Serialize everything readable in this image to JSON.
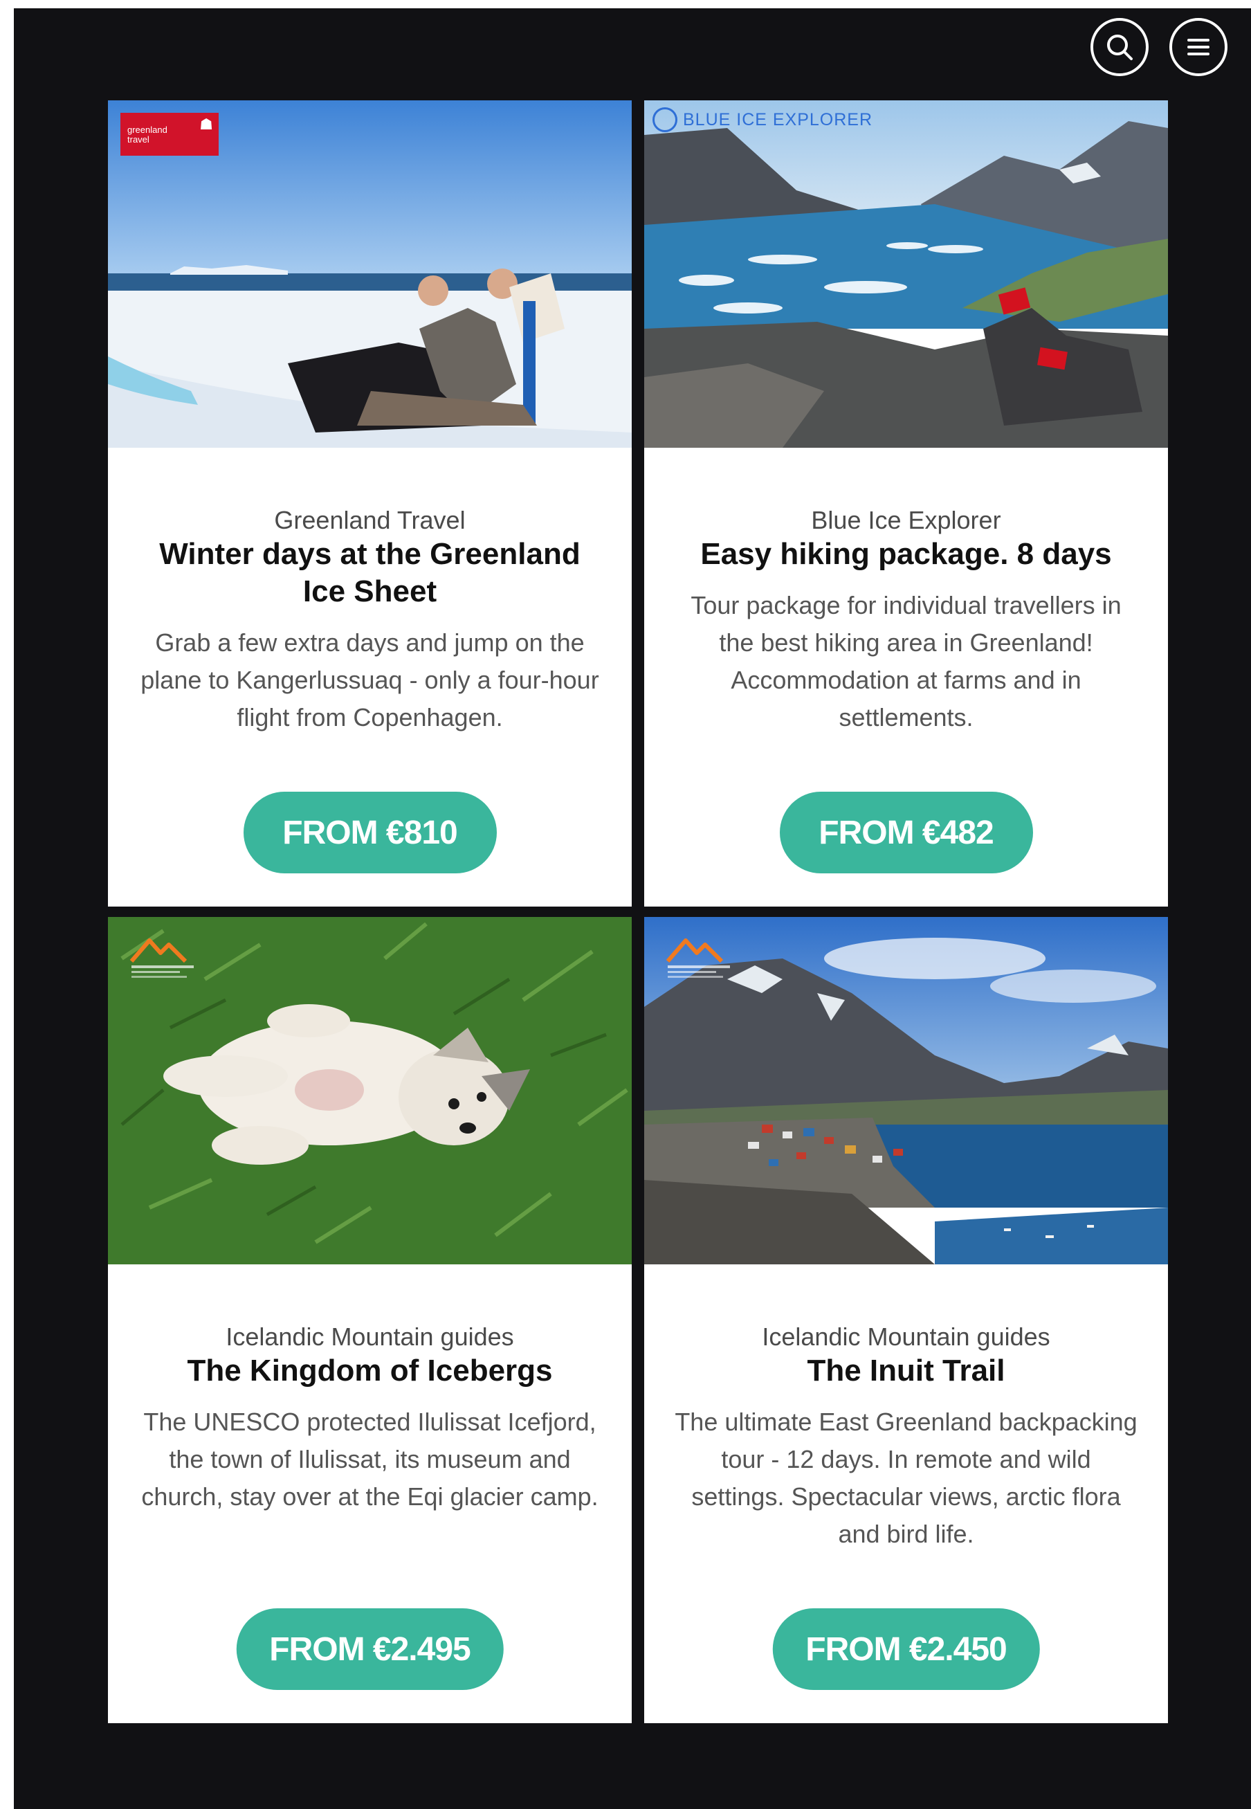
{
  "header": {
    "search_icon": "search-icon",
    "menu_icon": "hamburger-menu-icon"
  },
  "tours": [
    {
      "provider": "Greenland Travel",
      "title": "Winter days at the Greenland Ice Sheet",
      "description": "Grab a few extra days and jump on the plane to Kangerlussuaq - only a four-hour flight from Copenhagen.",
      "price": "FROM €810",
      "logo": {
        "line1": "greenland",
        "line2": "travel",
        "mark": "☗"
      }
    },
    {
      "provider": "Blue Ice Explorer",
      "title": "Easy hiking package. 8 days",
      "description": "Tour package for individual travellers in the best hiking area in Greenland! Accommodation at farms and in settlements.",
      "price": "FROM €482",
      "logo": {
        "text": "BLUE ICE EXPLORER"
      }
    },
    {
      "provider": "Icelandic Mountain guides",
      "title": "The Kingdom of Icebergs",
      "description": "The UNESCO protected Ilulissat Icefjord, the town of Ilulissat, its museum and church, stay over at the Eqi glacier camp.",
      "price": "FROM €2.495"
    },
    {
      "provider": "Icelandic Mountain guides",
      "title": "The Inuit Trail",
      "description": "The ultimate East Greenland backpacking tour - 12 days. In remote and wild settings. Spectacular views, arctic flora and bird life.",
      "price": "FROM €2.450"
    }
  ],
  "colors": {
    "background": "#111114",
    "card": "#ffffff",
    "accent": "#3ab69c",
    "brand_red": "#d1132a",
    "brand_blue": "#2f6fd6"
  }
}
